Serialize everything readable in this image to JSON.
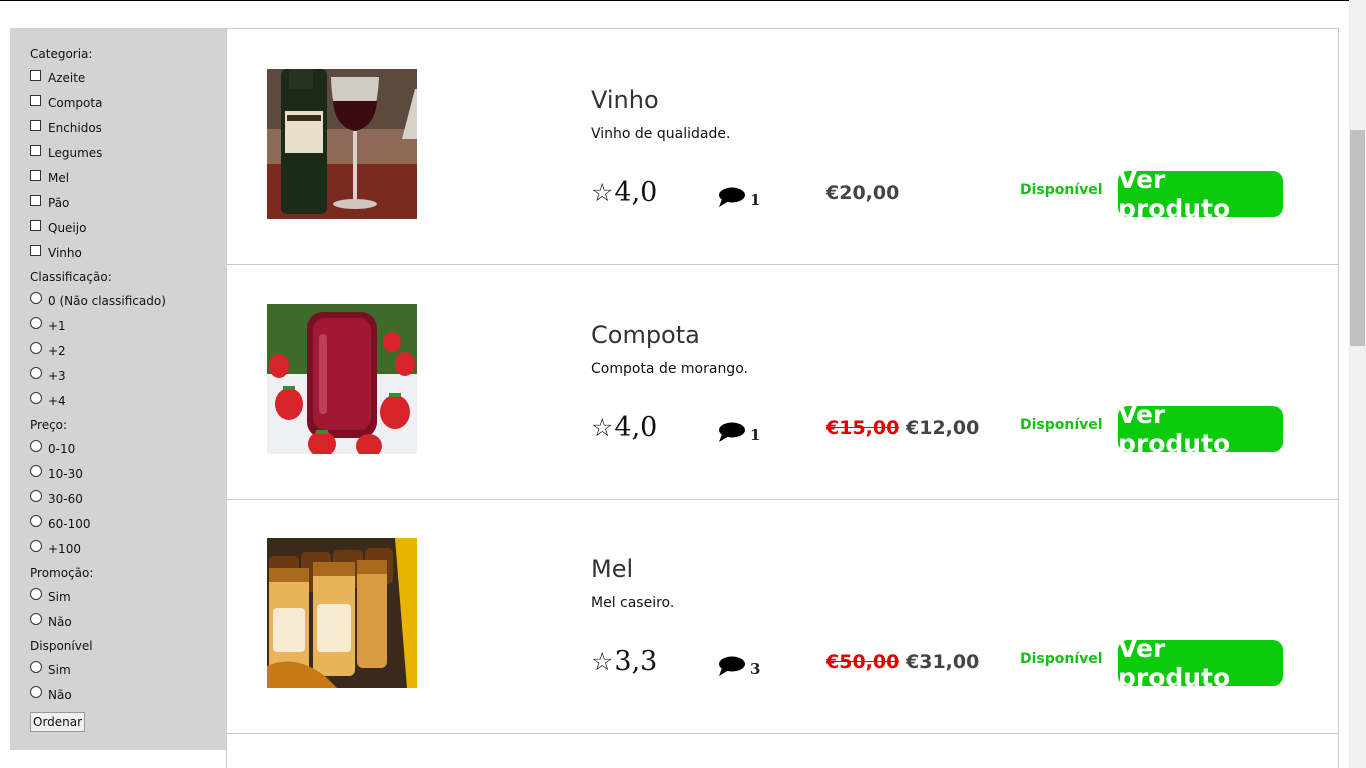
{
  "filters": {
    "category_heading": "Categoria:",
    "categories": [
      "Azeite",
      "Compota",
      "Enchidos",
      "Legumes",
      "Mel",
      "Pão",
      "Queijo",
      "Vinho"
    ],
    "rating_heading": "Classificação:",
    "ratings": [
      "0 (Não classificado)",
      "+1",
      "+2",
      "+3",
      "+4"
    ],
    "price_heading": "Preço:",
    "prices": [
      "0-10",
      "10-30",
      "30-60",
      "60-100",
      "+100"
    ],
    "promo_heading": "Promoção:",
    "promo_options": [
      "Sim",
      "Não"
    ],
    "available_heading": "Disponível",
    "available_options": [
      "Sim",
      "Não"
    ],
    "sort_button": "Ordenar"
  },
  "products": [
    {
      "name": "Vinho",
      "description": "Vinho de qualidade.",
      "rating": "4,0",
      "comments": "1",
      "old_price": "",
      "price": "€20,00",
      "status": "Disponível",
      "button": "Ver produto"
    },
    {
      "name": "Compota",
      "description": "Compota de morango.",
      "rating": "4,0",
      "comments": "1",
      "old_price": "€15,00",
      "price": "€12,00",
      "status": "Disponível",
      "button": "Ver produto"
    },
    {
      "name": "Mel",
      "description": "Mel caseiro.",
      "rating": "3,3",
      "comments": "3",
      "old_price": "€50,00",
      "price": "€31,00",
      "status": "Disponível",
      "button": "Ver produto"
    }
  ],
  "icons": {
    "rating": "star-outline-icon",
    "comments": "speech-bubble-icon"
  },
  "colors": {
    "available": "#19c019",
    "button": "#0cca0c",
    "old_price": "#e00000",
    "sidebar_bg": "#d3d3d3"
  }
}
